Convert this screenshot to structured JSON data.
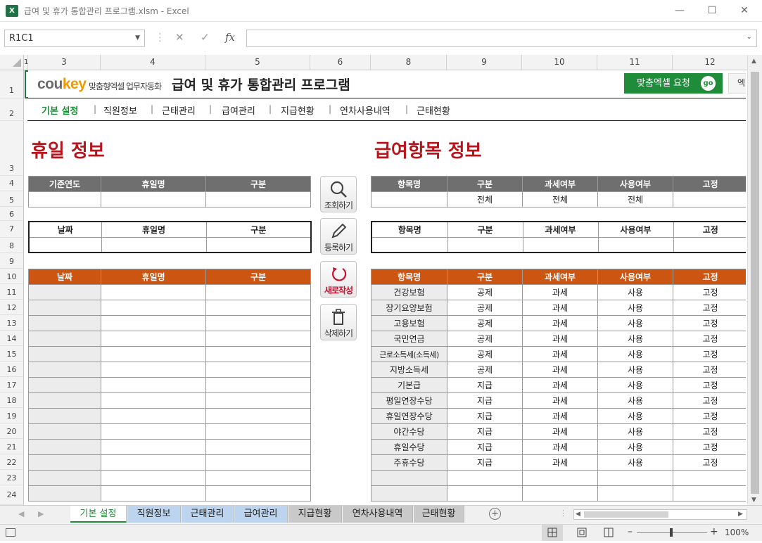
{
  "window": {
    "title": "급여 및 휴가 통합관리 프로그램.xlsm - Excel",
    "icon_label": "X"
  },
  "formula_bar": {
    "name_box": "R1C1",
    "cancel": "✕",
    "enter": "✓",
    "fx": "fx",
    "formula": ""
  },
  "columns": [
    "1",
    "3",
    "4",
    "5",
    "6",
    "8",
    "9",
    "10",
    "11",
    "12"
  ],
  "rows": [
    "1",
    "2",
    "3",
    "4",
    "5",
    "6",
    "7",
    "8",
    "9",
    "10",
    "11",
    "12",
    "13",
    "14",
    "15",
    "16",
    "17",
    "18",
    "19",
    "20",
    "21",
    "22",
    "23",
    "24"
  ],
  "header": {
    "logo_main": "cou",
    "logo_accent": "key",
    "logo_sub": "맞춤형엑셀 업무자동화",
    "program_title": "급여 및 휴가 통합관리 프로그램",
    "custom_request": "맞춤엑셀 요청",
    "go": "go",
    "extra_button": "엑"
  },
  "nav": [
    "기본 설정",
    "직원정보",
    "근태관리",
    "급여관리",
    "지급현황",
    "연차사용내역",
    "근태현황"
  ],
  "holiday": {
    "title": "휴일 정보",
    "search_headers": [
      "기준연도",
      "휴일명",
      "구분"
    ],
    "input_headers": [
      "날짜",
      "휴일명",
      "구분"
    ],
    "list_headers": [
      "날짜",
      "휴일명",
      "구분"
    ]
  },
  "buttons": {
    "search": "조회하기",
    "register": "등록하기",
    "new": "새로작성",
    "delete": "삭제하기"
  },
  "pay": {
    "title": "급여항목 정보",
    "headers": [
      "항목명",
      "구분",
      "과세여부",
      "사용여부",
      "고정"
    ],
    "filter": [
      "",
      "전체",
      "전체",
      "전체",
      ""
    ],
    "items": [
      [
        "건강보험",
        "공제",
        "과세",
        "사용",
        "고정"
      ],
      [
        "장기요양보험",
        "공제",
        "과세",
        "사용",
        "고정"
      ],
      [
        "고용보험",
        "공제",
        "과세",
        "사용",
        "고정"
      ],
      [
        "국민연금",
        "공제",
        "과세",
        "사용",
        "고정"
      ],
      [
        "근로소득세(소득세)",
        "공제",
        "과세",
        "사용",
        "고정"
      ],
      [
        "지방소득세",
        "공제",
        "과세",
        "사용",
        "고정"
      ],
      [
        "기본급",
        "지급",
        "과세",
        "사용",
        "고정"
      ],
      [
        "평일연장수당",
        "지급",
        "과세",
        "사용",
        "고정"
      ],
      [
        "휴일연장수당",
        "지급",
        "과세",
        "사용",
        "고정"
      ],
      [
        "야간수당",
        "지급",
        "과세",
        "사용",
        "고정"
      ],
      [
        "휴일수당",
        "지급",
        "과세",
        "사용",
        "고정"
      ],
      [
        "주휴수당",
        "지급",
        "과세",
        "사용",
        "고정"
      ]
    ]
  },
  "sheet_tabs": [
    "기본 설정",
    "직원정보",
    "근태관리",
    "급여관리",
    "지급현황",
    "연차사용내역",
    "근태현황"
  ],
  "status": {
    "zoom": "100%"
  },
  "colors": {
    "accent_red": "#b7141b",
    "header_orange": "#cc5512",
    "header_gray": "#6f6f6f",
    "brand_green": "#1f8c3a"
  }
}
